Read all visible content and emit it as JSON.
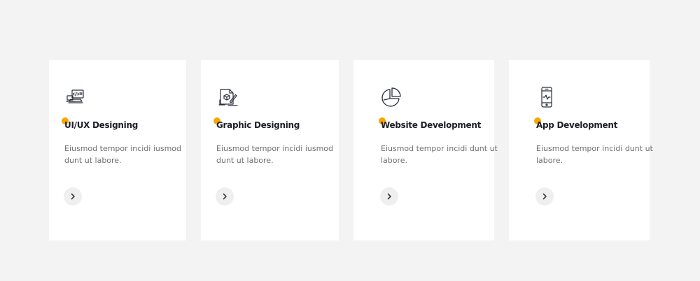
{
  "services": [
    {
      "title": "UI/UX Designing",
      "description": "Eiusmod tempor incidi iusmod dunt ut labore.",
      "icon": "laptop-code-icon"
    },
    {
      "title": "Graphic Designing",
      "description": "Eiusmod tempor incidi iusmod dunt ut labore.",
      "icon": "design-tools-icon"
    },
    {
      "title": "Website Development",
      "description": "Eiusmod tempor incidi dunt ut labore.",
      "icon": "pie-chart-icon"
    },
    {
      "title": "App Development",
      "description": "Eiusmod tempor incidi dunt ut labore.",
      "icon": "smartphone-heartbeat-icon"
    }
  ],
  "colors": {
    "page_background": "#f3f3f3",
    "card_background": "#ffffff",
    "accent": "#f6a800",
    "title": "#1c1f26",
    "text": "#6f6f6f",
    "button_background": "#efefef"
  },
  "arrow_icon": "chevron-right-icon"
}
